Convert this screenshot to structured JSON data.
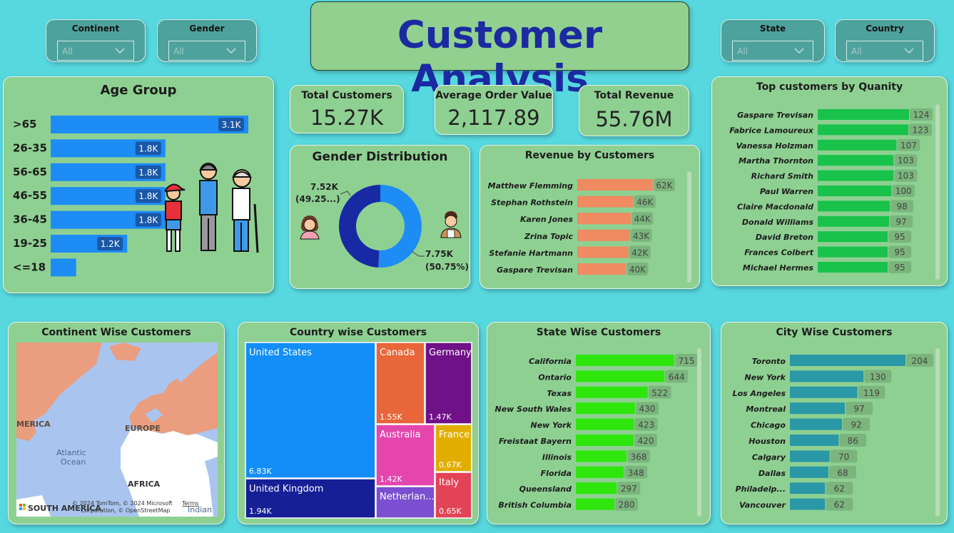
{
  "title": "Customer Analysis",
  "slicers": [
    {
      "label": "Continent",
      "value": "All"
    },
    {
      "label": "Gender",
      "value": "All"
    },
    {
      "label": "State",
      "value": "All"
    },
    {
      "label": "Country",
      "value": "All"
    }
  ],
  "kpis": [
    {
      "label": "Total Customers",
      "value": "15.27K"
    },
    {
      "label": "Average Order Value",
      "value": "2,117.89"
    },
    {
      "label": "Total Revenue",
      "value": "55.76M"
    }
  ],
  "map": {
    "attribution_1": "© 2024 TomTom, © 2024 Microsoft",
    "attribution_2": "Corporation, © OpenStreetMap",
    "terms": "Terms",
    "labels": {
      "america": "MERICA",
      "europe": "EUROPE",
      "atlantic": "Atlantic",
      "ocean": "Ocean",
      "africa": "AFRICA",
      "south_america": "SOUTH AMERICA",
      "indian": "Indian",
      "indian_ocean": "Ocean"
    }
  },
  "chart_data": [
    {
      "id": "age",
      "type": "bar",
      "title": "Age Group",
      "categories": [
        ">65",
        "26-35",
        "56-65",
        "46-55",
        "36-45",
        "19-25",
        "<=18"
      ],
      "values": [
        3100,
        1800,
        1800,
        1800,
        1800,
        1200,
        400
      ],
      "labels": [
        "3.1K",
        "1.8K",
        "1.8K",
        "1.8K",
        "1.8K",
        "1.2K",
        ""
      ],
      "color": "#1d8cf5"
    },
    {
      "id": "gender",
      "type": "pie",
      "title": "Gender Distribution",
      "slices": [
        {
          "value": 7520,
          "label": "7.52K",
          "pct": "(49.25...)",
          "color": "#172aa4"
        },
        {
          "value": 7750,
          "label": "7.75K",
          "pct": "(50.75%)",
          "color": "#1d8cf5"
        }
      ]
    },
    {
      "id": "revenue",
      "type": "bar",
      "title": "Revenue by Customers",
      "categories": [
        "Matthew Flemming",
        "Stephan Rothstein",
        "Karen Jones",
        "Zrina Topic",
        "Stefanie Hartmann",
        "Gaspare Trevisan"
      ],
      "values": [
        62000,
        46000,
        44000,
        43000,
        42000,
        40000
      ],
      "labels": [
        "62K",
        "46K",
        "44K",
        "43K",
        "42K",
        "40K"
      ],
      "color": "#ef8a61"
    },
    {
      "id": "topqty",
      "type": "bar",
      "title": "Top customers by Quanity",
      "categories": [
        "Gaspare Trevisan",
        "Fabrice Lamoureux",
        "Vanessa Holzman",
        "Martha Thornton",
        "Richard Smith",
        "Paul Warren",
        "Claire Macdonald",
        "Donald Williams",
        "David Breton",
        "Frances Colbert",
        "Michael Hermes"
      ],
      "values": [
        124,
        123,
        107,
        103,
        103,
        100,
        98,
        97,
        95,
        95,
        95
      ],
      "color": "#19c24a"
    },
    {
      "id": "treemap",
      "type": "treemap",
      "title": "Country wise Customers",
      "items": [
        {
          "name": "United States",
          "value": "6.83K",
          "color": "#138ef8"
        },
        {
          "name": "Canada",
          "value": "1.55K",
          "color": "#e8663a"
        },
        {
          "name": "Germany",
          "value": "1.47K",
          "color": "#6f1187"
        },
        {
          "name": "Australia",
          "value": "1.42K",
          "color": "#e446ae"
        },
        {
          "name": "France",
          "value": "0.67K",
          "color": "#e1ae00"
        },
        {
          "name": "United Kingdom",
          "value": "1.94K",
          "color": "#161f96"
        },
        {
          "name": "Netherlan...",
          "value": "",
          "color": "#7b4fd0"
        },
        {
          "name": "Italy",
          "value": "0.65K",
          "color": "#e24456"
        }
      ]
    },
    {
      "id": "state",
      "type": "bar",
      "title": "State Wise Customers",
      "categories": [
        "California",
        "Ontario",
        "Texas",
        "New South Wales",
        "New York",
        "Freistaat Bayern",
        "Illinois",
        "Florida",
        "Queensland",
        "British Columbia"
      ],
      "values": [
        715,
        644,
        522,
        430,
        423,
        420,
        368,
        348,
        297,
        280
      ],
      "color": "#2ee60e"
    },
    {
      "id": "city",
      "type": "bar",
      "title": "City Wise Customers",
      "categories": [
        "Toronto",
        "New York",
        "Los Angeles",
        "Montreal",
        "Chicago",
        "Houston",
        "Calgary",
        "Dallas",
        "Philadelp...",
        "Vancouver"
      ],
      "values": [
        204,
        130,
        119,
        97,
        92,
        86,
        70,
        68,
        62,
        62
      ],
      "color": "#2a98a6"
    }
  ],
  "panel_titles": {
    "continent": "Continent Wise Customers"
  },
  "colors": {
    "background": "#56d8de",
    "panel": "#8ed092",
    "title_text": "#1b2aa0",
    "value_box": "#7bb57d"
  }
}
